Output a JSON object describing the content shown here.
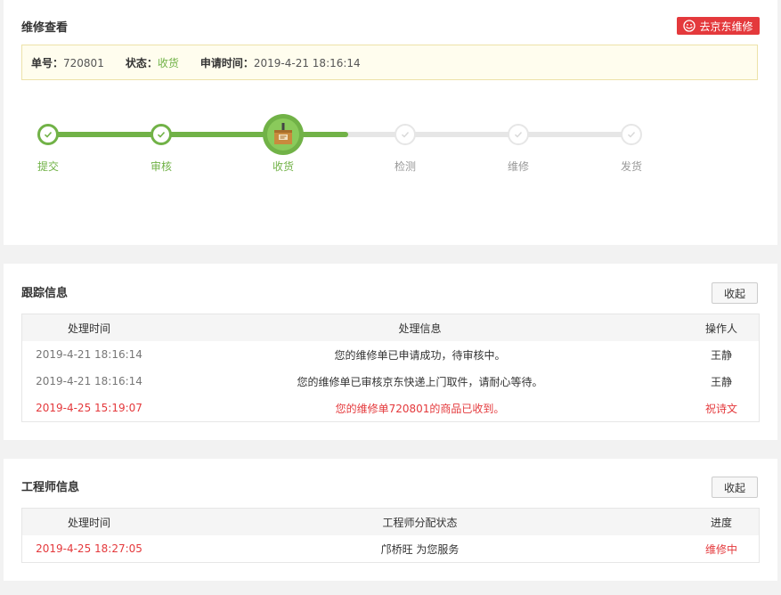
{
  "repair": {
    "title": "维修查看",
    "jd_button": "去京东维修",
    "info": {
      "order_label": "单号：",
      "order_value": "720801",
      "status_label": "状态：",
      "status_value": "收货",
      "time_label": "申请时间：",
      "time_value": "2019-4-21 18:16:14"
    },
    "steps": [
      {
        "label": "提交",
        "state": "done"
      },
      {
        "label": "审核",
        "state": "done"
      },
      {
        "label": "收货",
        "state": "current"
      },
      {
        "label": "检测",
        "state": "todo"
      },
      {
        "label": "维修",
        "state": "todo"
      },
      {
        "label": "发货",
        "state": "todo"
      }
    ]
  },
  "tracking": {
    "title": "跟踪信息",
    "collapse_label": "收起",
    "columns": [
      "处理时间",
      "处理信息",
      "操作人"
    ],
    "rows": [
      {
        "time": "2019-4-21 18:16:14",
        "info": "您的维修单已申请成功，待审核中。",
        "operator": "王静"
      },
      {
        "time": "2019-4-21 18:16:14",
        "info": "您的维修单已审核京东快递上门取件，请耐心等待。",
        "operator": "王静"
      },
      {
        "time": "2019-4-25 15:19:07",
        "info": "您的维修单720801的商品已收到。",
        "operator": "祝诗文"
      }
    ]
  },
  "engineer": {
    "title": "工程师信息",
    "collapse_label": "收起",
    "columns": [
      "处理时间",
      "工程师分配状态",
      "进度"
    ],
    "rows": [
      {
        "time": "2019-4-25 18:27:05",
        "status": "邝桥旺 为您服务",
        "progress": "维修中"
      }
    ]
  },
  "colors": {
    "green": "#71b247",
    "red": "#e4393c",
    "notice_bg": "#fffdee"
  },
  "icons": {
    "check": "check-icon",
    "box": "package-icon",
    "service": "customer-service-icon"
  }
}
